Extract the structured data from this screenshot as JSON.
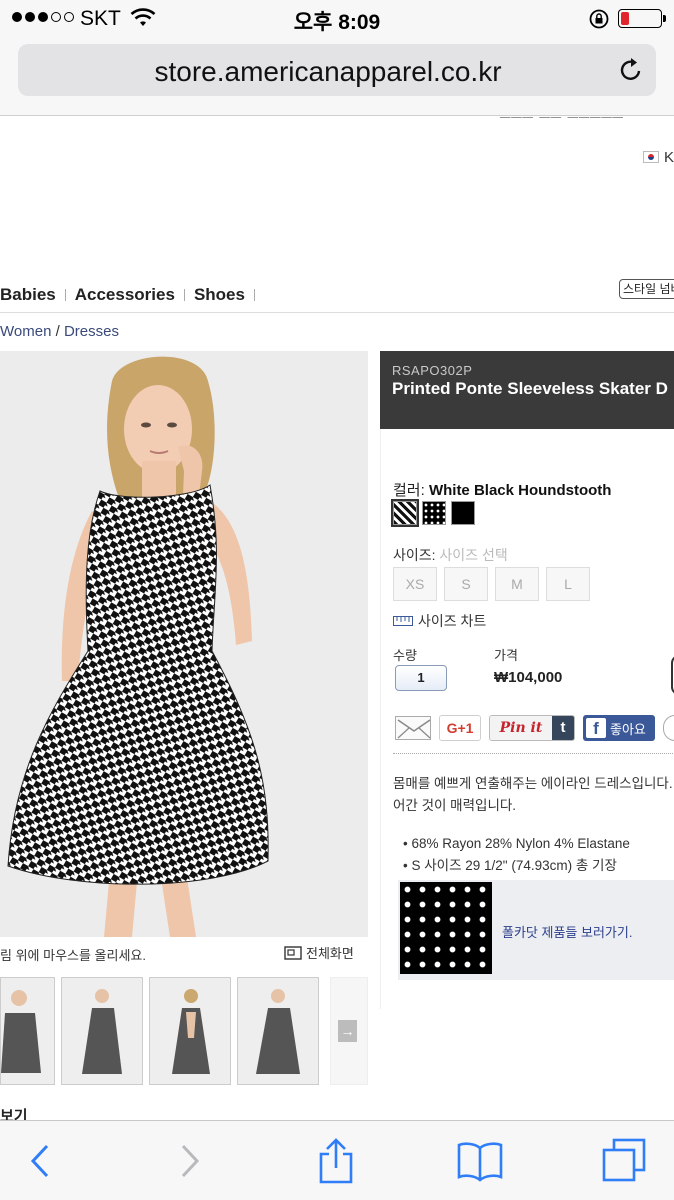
{
  "status_bar": {
    "carrier": "SKT",
    "time": "오후 8:09",
    "signal_bars": 3,
    "signal_total": 5,
    "battery_level": 0.2,
    "battery_color": "#e0262c",
    "icons": [
      "signal-dots-icon",
      "wifi-icon",
      "orientation-lock-icon",
      "battery-icon"
    ]
  },
  "browser": {
    "url": "store.americanapparel.co.kr",
    "reload_icon": "reload-icon",
    "toolbar_icons": [
      "back-icon",
      "forward-icon",
      "share-icon",
      "bookmarks-icon",
      "tabs-icon"
    ]
  },
  "header": {
    "lang_label": "K",
    "flag_icon": "korea-flag-icon",
    "style_button": "스타일 넘버"
  },
  "nav": {
    "items": [
      "Babies",
      "Accessories",
      "Shoes"
    ]
  },
  "breadcrumb": {
    "items": [
      "Women",
      "Dresses"
    ],
    "separator": "/"
  },
  "gallery": {
    "hover_hint": "림 위에 마우스를 올리세요.",
    "fullscreen_label": "전체화면",
    "thumbnail_count": 4,
    "next_icon": "arrow-right-icon",
    "recent_label": "보기"
  },
  "product": {
    "sku": "RSAPO302P",
    "name": "Printed Ponte Sleeveless Skater D",
    "color_label": "컬러:",
    "color_value": "White Black Houndstooth",
    "swatches": [
      "white-black-houndstooth",
      "polka-dot",
      "black"
    ],
    "size_label": "사이즈:",
    "size_placeholder": "사이즈 선택",
    "sizes": [
      "XS",
      "S",
      "M",
      "L"
    ],
    "size_chart_label": "사이즈 차트",
    "qty_label": "수량",
    "qty_value": "1",
    "price_label": "가격",
    "price": "₩104,000",
    "share": {
      "gplus": "G+1",
      "pinit": "Pin it",
      "tumblr": "t",
      "facebook_f": "f",
      "facebook_like": "좋아요"
    },
    "description": [
      "몸매를 예쁘게 연출해주는 에이라인 드레스입니다.",
      "어간 것이 매력입니다."
    ],
    "bullets": [
      "68% Rayon 28% Nylon 4% Elastane",
      "S 사이즈 29 1/2\" (74.93cm) 총 기장"
    ],
    "banner_text": "폴카닷 제품들 보러가기."
  },
  "colors": {
    "panel_header": "#3a3a3a",
    "link": "#3a4a7a",
    "ios_blue": "#2f7ef7",
    "facebook": "#3b5998"
  }
}
